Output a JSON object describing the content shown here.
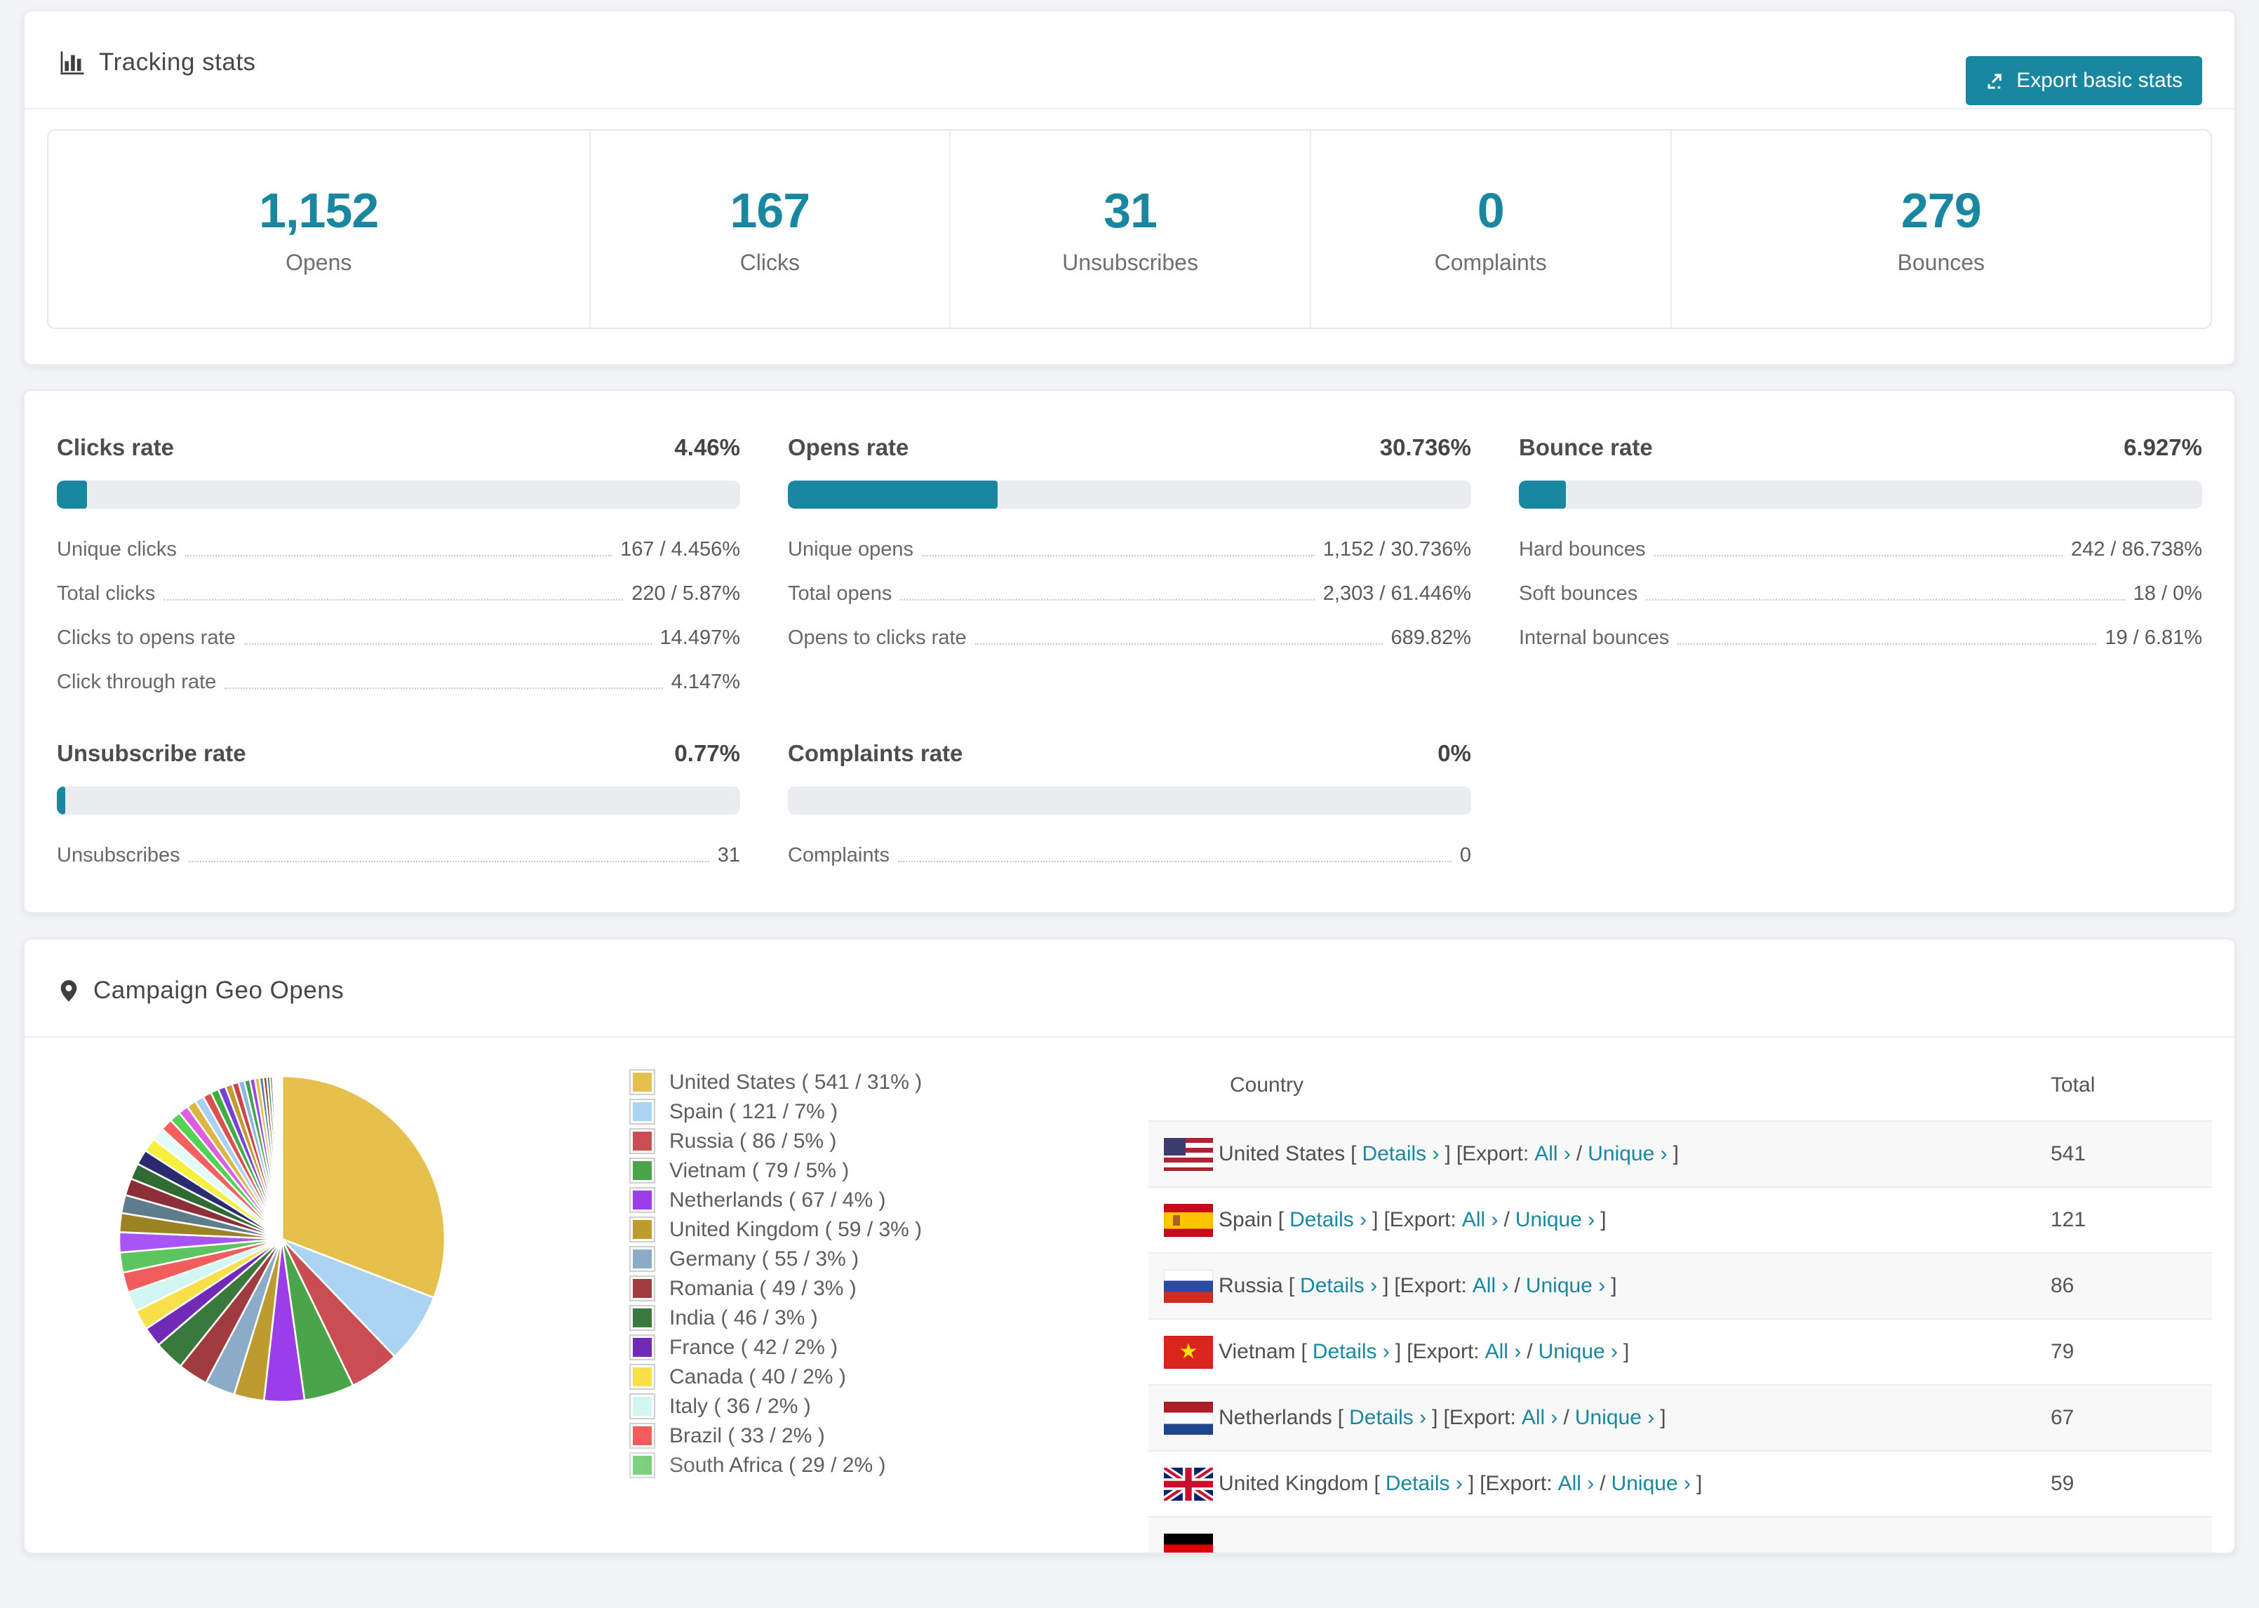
{
  "theme": {
    "accent": "#1a87a0",
    "track": "#eaedf0"
  },
  "icons": {
    "header": "bar-chart-icon",
    "export": "export-icon",
    "geo": "map-marker-icon"
  },
  "tracking_stats": {
    "title": "Tracking stats",
    "export_button": "Export basic stats",
    "counters": [
      {
        "value": "1,152",
        "label": "Opens"
      },
      {
        "value": "167",
        "label": "Clicks"
      },
      {
        "value": "31",
        "label": "Unsubscribes"
      },
      {
        "value": "0",
        "label": "Complaints"
      },
      {
        "value": "279",
        "label": "Bounces"
      }
    ]
  },
  "rates": [
    {
      "title": "Clicks rate",
      "value": "4.46%",
      "percent": 4.46,
      "rows": [
        {
          "label": "Unique clicks",
          "value": "167 / 4.456%"
        },
        {
          "label": "Total clicks",
          "value": "220 / 5.87%"
        },
        {
          "label": "Clicks to opens rate",
          "value": "14.497%"
        },
        {
          "label": "Click through rate",
          "value": "4.147%"
        }
      ]
    },
    {
      "title": "Opens rate",
      "value": "30.736%",
      "percent": 30.736,
      "rows": [
        {
          "label": "Unique opens",
          "value": "1,152 / 30.736%"
        },
        {
          "label": "Total opens",
          "value": "2,303 / 61.446%"
        },
        {
          "label": "Opens to clicks rate",
          "value": "689.82%"
        }
      ]
    },
    {
      "title": "Bounce rate",
      "value": "6.927%",
      "percent": 6.927,
      "rows": [
        {
          "label": "Hard bounces",
          "value": "242 / 86.738%"
        },
        {
          "label": "Soft bounces",
          "value": "18 / 0%"
        },
        {
          "label": "Internal bounces",
          "value": "19 / 6.81%"
        }
      ]
    },
    {
      "title": "Unsubscribe rate",
      "value": "0.77%",
      "percent": 0.77,
      "rows": [
        {
          "label": "Unsubscribes",
          "value": "31"
        }
      ]
    },
    {
      "title": "Complaints rate",
      "value": "0%",
      "percent": 0,
      "rows": [
        {
          "label": "Complaints",
          "value": "0"
        }
      ]
    }
  ],
  "geo": {
    "title": "Campaign Geo Opens",
    "table": {
      "columns": [
        "Country",
        "Total"
      ],
      "link_labels": {
        "open": "[",
        "details": "Details ›",
        "close": "]",
        "export_open": "[Export:",
        "all": "All ›",
        "slash": "/",
        "unique": "Unique ›",
        "close2": "]"
      },
      "rows": [
        {
          "country": "United States",
          "total": "541",
          "flag": "us"
        },
        {
          "country": "Spain",
          "total": "121",
          "flag": "es"
        },
        {
          "country": "Russia",
          "total": "86",
          "flag": "ru"
        },
        {
          "country": "Vietnam",
          "total": "79",
          "flag": "vn"
        },
        {
          "country": "Netherlands",
          "total": "67",
          "flag": "nl"
        },
        {
          "country": "United Kingdom",
          "total": "59",
          "flag": "gb"
        },
        {
          "country": "",
          "total": "",
          "flag": "de",
          "partially_visible": true
        }
      ]
    }
  },
  "chart_data": {
    "type": "pie",
    "title": "Campaign Geo Opens",
    "legend_position": "right-of-pie",
    "start_angle_deg": -90,
    "direction": "clockwise",
    "slices": [
      {
        "label": "United States",
        "value": 541,
        "pct": 31,
        "color": "#e5c04a",
        "display": "United States ( 541 / 31% )"
      },
      {
        "label": "Spain",
        "value": 121,
        "pct": 7,
        "color": "#abd3f2",
        "display": "Spain ( 121 / 7% )"
      },
      {
        "label": "Russia",
        "value": 86,
        "pct": 5,
        "color": "#c94d52",
        "display": "Russia ( 86 / 5% )"
      },
      {
        "label": "Vietnam",
        "value": 79,
        "pct": 5,
        "color": "#4aa44a",
        "display": "Vietnam ( 79 / 5% )"
      },
      {
        "label": "Netherlands",
        "value": 67,
        "pct": 4,
        "color": "#9b3de8",
        "display": "Netherlands ( 67 / 4% )"
      },
      {
        "label": "United Kingdom",
        "value": 59,
        "pct": 3,
        "color": "#bd9b2e",
        "display": "United Kingdom ( 59 / 3% )"
      },
      {
        "label": "Germany",
        "value": 55,
        "pct": 3,
        "color": "#8cabc9",
        "display": "Germany ( 55 / 3% )"
      },
      {
        "label": "Romania",
        "value": 49,
        "pct": 3,
        "color": "#a03b40",
        "display": "Romania ( 49 / 3% )"
      },
      {
        "label": "India",
        "value": 46,
        "pct": 3,
        "color": "#39793d",
        "display": "India ( 46 / 3% )"
      },
      {
        "label": "France",
        "value": 42,
        "pct": 2,
        "color": "#7129b8",
        "display": "France ( 42 / 2% )"
      },
      {
        "label": "Canada",
        "value": 40,
        "pct": 2,
        "color": "#f8e04b",
        "display": "Canada ( 40 / 2% )"
      },
      {
        "label": "Italy",
        "value": 36,
        "pct": 2,
        "color": "#d2f7f3",
        "display": "Italy ( 36 / 2% )"
      },
      {
        "label": "Brazil",
        "value": 33,
        "pct": 2,
        "color": "#f15d5d",
        "display": "Brazil ( 33 / 2% )"
      },
      {
        "label": "South Africa",
        "value": 29,
        "pct": 2,
        "color": "#5dc560",
        "display": "South Africa ( 29 / 2% )"
      }
    ],
    "unlabeled_small_slices": [
      {
        "pct": 2.0,
        "color": "#a855f7"
      },
      {
        "pct": 1.9,
        "color": "#9c8322"
      },
      {
        "pct": 1.8,
        "color": "#5f7c8c"
      },
      {
        "pct": 1.7,
        "color": "#8c2f39"
      },
      {
        "pct": 1.6,
        "color": "#2f6b33"
      },
      {
        "pct": 1.5,
        "color": "#2b2a6e"
      },
      {
        "pct": 1.4,
        "color": "#f7ef3f"
      },
      {
        "pct": 1.3,
        "color": "#e4fbf8"
      },
      {
        "pct": 1.2,
        "color": "#f56060"
      },
      {
        "pct": 1.1,
        "color": "#54d254"
      },
      {
        "pct": 1.0,
        "color": "#dd5fdd"
      },
      {
        "pct": 0.95,
        "color": "#ddb53f"
      },
      {
        "pct": 0.9,
        "color": "#a9cff2"
      },
      {
        "pct": 0.85,
        "color": "#dd4f4f"
      },
      {
        "pct": 0.8,
        "color": "#3fae3f"
      },
      {
        "pct": 0.75,
        "color": "#7a3fd9"
      },
      {
        "pct": 0.7,
        "color": "#bf9b30"
      },
      {
        "pct": 0.65,
        "color": "#cc4444"
      },
      {
        "pct": 0.6,
        "color": "#88b8e8"
      },
      {
        "pct": 0.55,
        "color": "#44a044"
      },
      {
        "pct": 0.5,
        "color": "#9944ee"
      },
      {
        "pct": 0.45,
        "color": "#ddc040"
      },
      {
        "pct": 0.4,
        "color": "#4f7f9f"
      },
      {
        "pct": 0.35,
        "color": "#993333"
      },
      {
        "pct": 0.3,
        "color": "#227722"
      },
      {
        "pct": 0.25,
        "color": "#333377"
      },
      {
        "pct": 0.2,
        "color": "#eeee44"
      },
      {
        "pct": 0.18,
        "color": "#ccf5f0"
      },
      {
        "pct": 0.15,
        "color": "#ee7777"
      },
      {
        "pct": 0.12,
        "color": "#66cc66"
      },
      {
        "pct": 0.1,
        "color": "#cc66cc"
      },
      {
        "pct": 0.08,
        "color": "#ccaa33"
      },
      {
        "pct": 0.06,
        "color": "#99bbee"
      },
      {
        "pct": 0.05,
        "color": "#cc5555"
      }
    ]
  }
}
